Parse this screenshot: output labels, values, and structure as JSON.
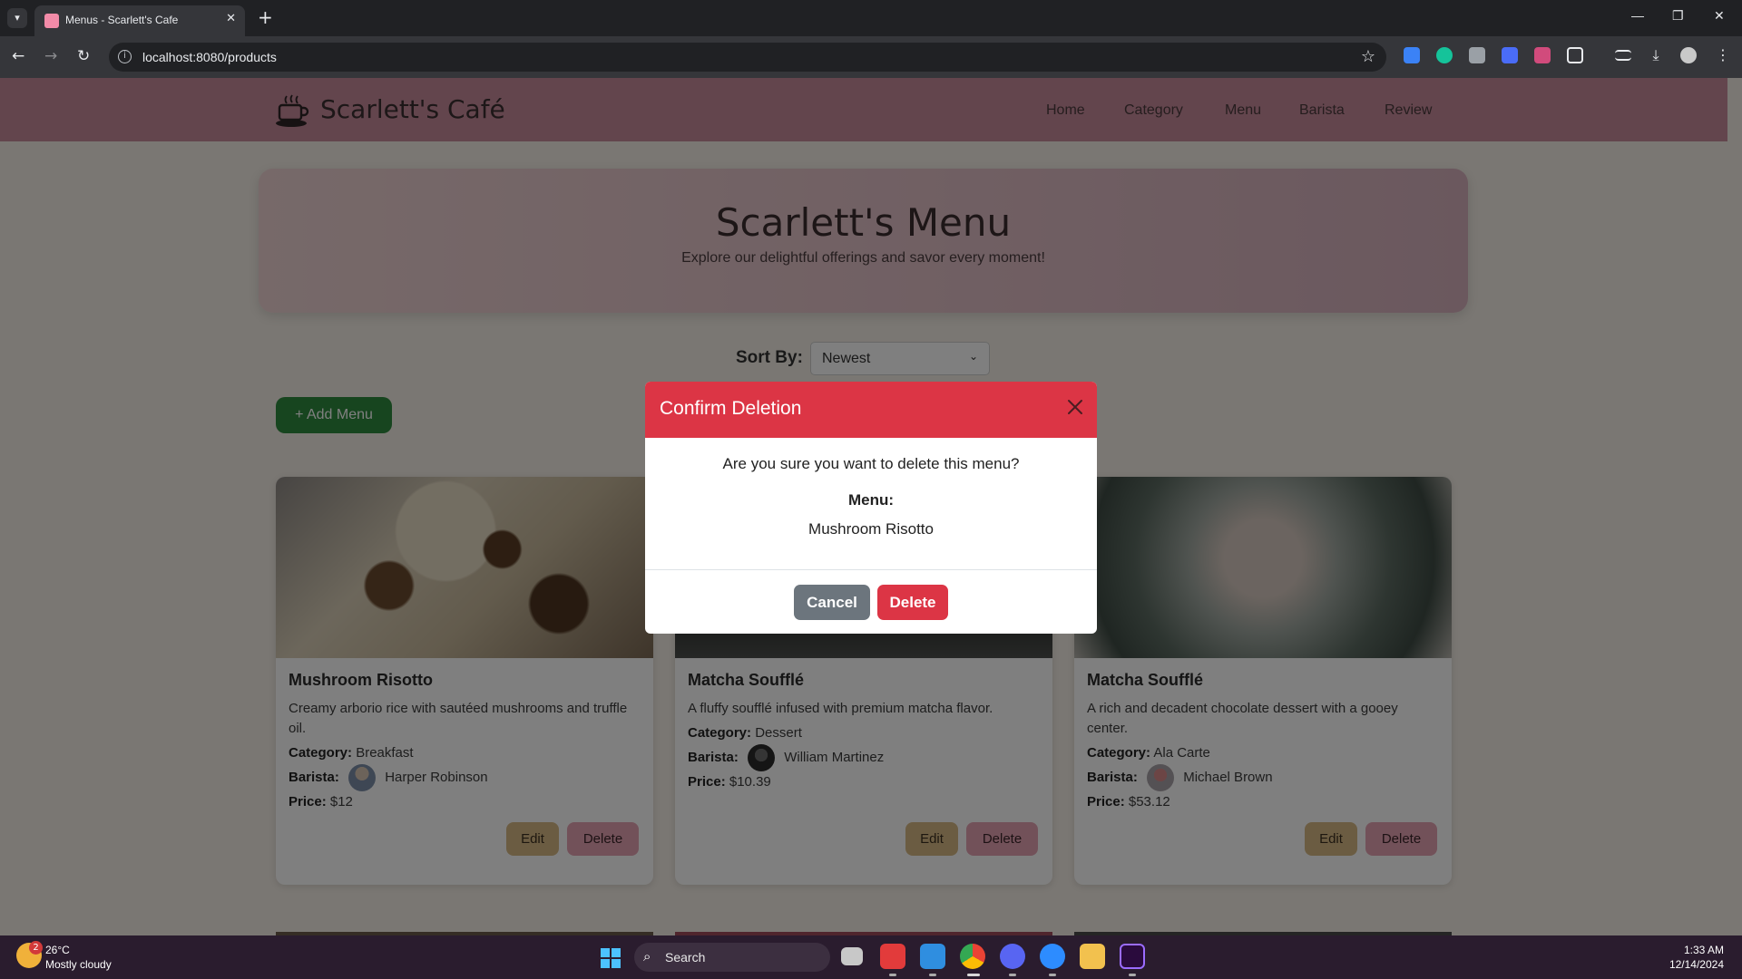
{
  "browser": {
    "tab_title": "Menus - Scarlett's Cafe",
    "tab_close": "✕",
    "new_tab": "+",
    "url": "localhost:8080/products",
    "window_controls": [
      "—",
      "❐",
      "✕"
    ]
  },
  "site": {
    "brand": "Scarlett's Café",
    "nav": [
      "Home",
      "Category",
      "Menu",
      "Barista",
      "Review"
    ],
    "hero_title": "Scarlett's Menu",
    "hero_subtitle": "Explore our delightful offerings and savor every moment!",
    "sort_label": "Sort By:",
    "sort_value": "Newest",
    "add_button": "+ Add Menu"
  },
  "cards": [
    {
      "title": "Mushroom Risotto",
      "description": "Creamy arborio rice with sautéed mushrooms and truffle oil.",
      "category_label": "Category:",
      "category": "Breakfast",
      "barista_label": "Barista:",
      "barista": "Harper Robinson",
      "price_label": "Price:",
      "price": "$12",
      "edit": "Edit",
      "delete": "Delete"
    },
    {
      "title": "Matcha Soufflé",
      "description": "A fluffy soufflé infused with premium matcha flavor.",
      "category_label": "Category:",
      "category": "Dessert",
      "barista_label": "Barista:",
      "barista": "William Martinez",
      "price_label": "Price:",
      "price": "$10.39",
      "edit": "Edit",
      "delete": "Delete"
    },
    {
      "title": "Matcha Soufflé",
      "description": "A rich and decadent chocolate dessert with a gooey center.",
      "category_label": "Category:",
      "category": "Ala Carte",
      "barista_label": "Barista:",
      "barista": "Michael Brown",
      "price_label": "Price:",
      "price": "$53.12",
      "edit": "Edit",
      "delete": "Delete"
    }
  ],
  "modal": {
    "title": "Confirm Deletion",
    "question": "Are you sure you want to delete this menu?",
    "menu_label": "Menu:",
    "menu_name": "Mushroom Risotto",
    "cancel": "Cancel",
    "delete": "Delete"
  },
  "taskbar": {
    "weather_temp": "26°C",
    "weather_desc": "Mostly cloudy",
    "weather_badge": "2",
    "search_placeholder": "Search",
    "time": "1:33 AM",
    "date": "12/14/2024"
  },
  "colors": {
    "accent_red": "#dc3545",
    "navbar_pink": "#c68a9a",
    "add_green": "#2f8a3e",
    "edit_tan": "#d7b985",
    "delete_pink": "#e5a2b3",
    "cancel_gray": "#6c757d"
  }
}
